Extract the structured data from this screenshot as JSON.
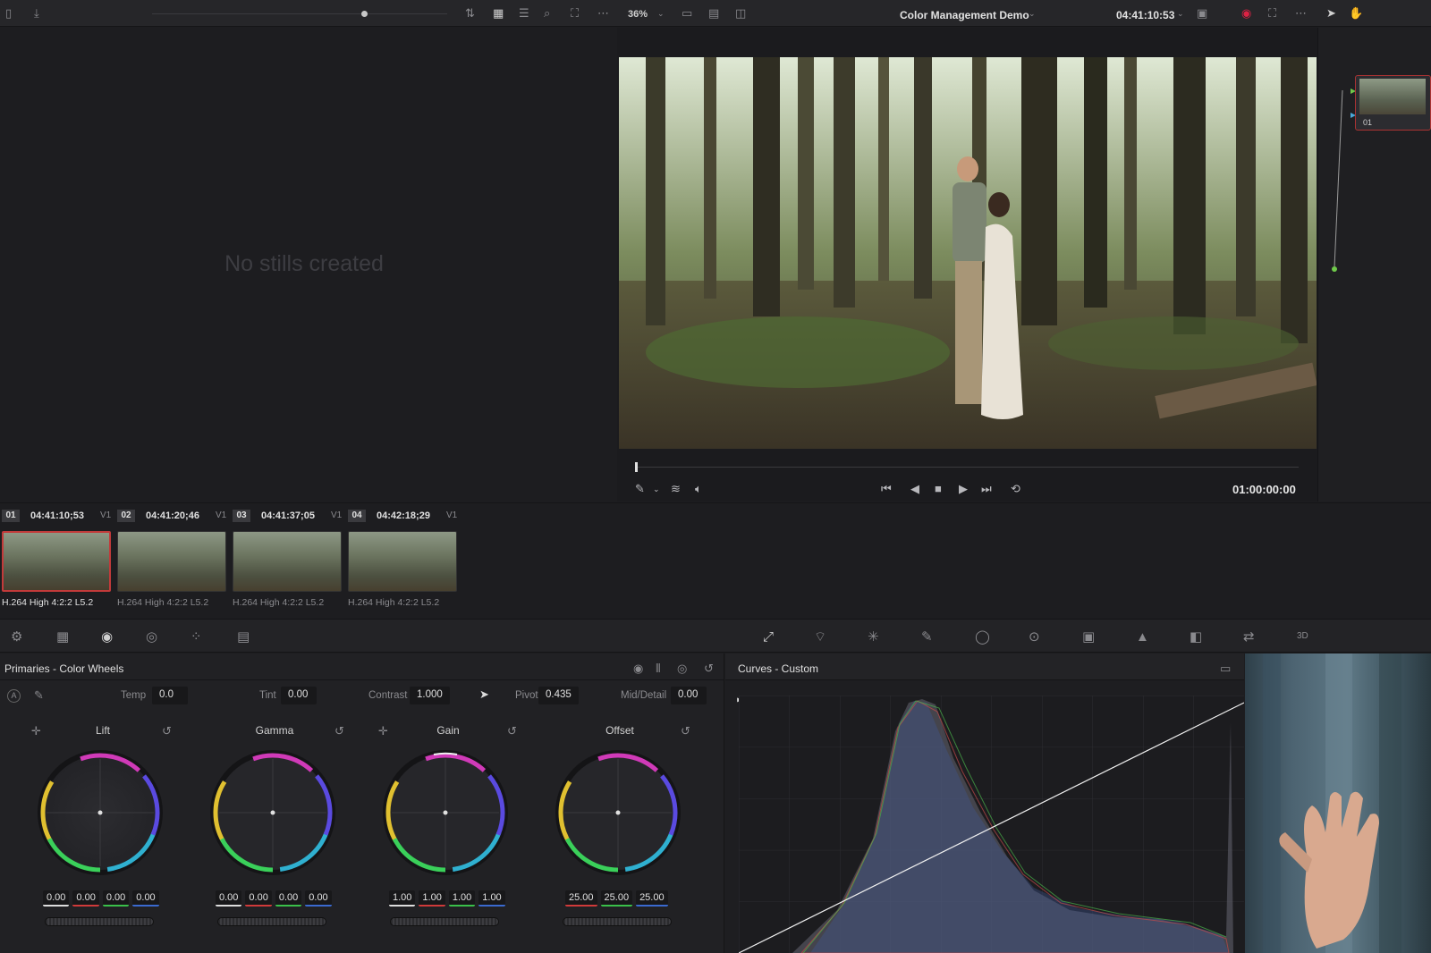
{
  "topbar": {
    "zoom": "36%",
    "project_title": "Color Management Demo",
    "timecode": "04:41:10:53"
  },
  "gallery": {
    "empty_message": "No stills created"
  },
  "viewer": {
    "timecode": "01:00:00:00"
  },
  "node_graph": {
    "node_label": "01"
  },
  "clips": [
    {
      "num": "01",
      "timecode": "04:41:10;53",
      "track": "V1",
      "codec": "H.264 High 4:2:2 L5.2",
      "selected": true
    },
    {
      "num": "02",
      "timecode": "04:41:20;46",
      "track": "V1",
      "codec": "H.264 High 4:2:2 L5.2",
      "selected": false
    },
    {
      "num": "03",
      "timecode": "04:41:37;05",
      "track": "V1",
      "codec": "H.264 High 4:2:2 L5.2",
      "selected": false
    },
    {
      "num": "04",
      "timecode": "04:42:18;29",
      "track": "V1",
      "codec": "H.264 High 4:2:2 L5.2",
      "selected": false
    }
  ],
  "primaries": {
    "title": "Primaries - Color Wheels",
    "temp_label": "Temp",
    "temp_value": "0.0",
    "tint_label": "Tint",
    "tint_value": "0.00",
    "contrast_label": "Contrast",
    "contrast_value": "1.000",
    "pivot_label": "Pivot",
    "pivot_value": "0.435",
    "middetail_label": "Mid/Detail",
    "middetail_value": "0.00",
    "wheels": [
      {
        "name": "Lift",
        "values": [
          "0.00",
          "0.00",
          "0.00",
          "0.00"
        ]
      },
      {
        "name": "Gamma",
        "values": [
          "0.00",
          "0.00",
          "0.00",
          "0.00"
        ]
      },
      {
        "name": "Gain",
        "values": [
          "1.00",
          "1.00",
          "1.00",
          "1.00"
        ]
      },
      {
        "name": "Offset",
        "values": [
          "25.00",
          "25.00",
          "25.00"
        ]
      }
    ]
  },
  "curves": {
    "title": "Curves - Custom"
  },
  "colors": {
    "accent_red": "#c23a3a",
    "panel_bg": "#212124",
    "text": "#e0e0e0"
  }
}
